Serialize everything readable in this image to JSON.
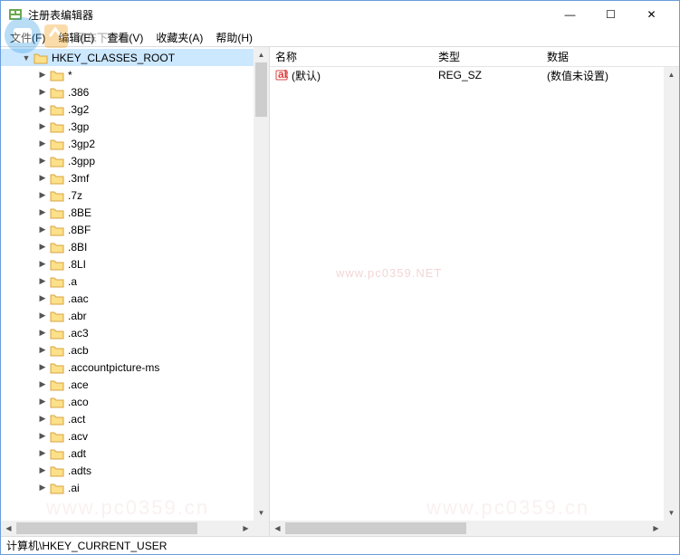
{
  "window": {
    "title": "注册表编辑器"
  },
  "menu": {
    "file": "文件(F)",
    "edit": "编辑(E)",
    "view": "查看(V)",
    "favorites": "收藏夹(A)",
    "help": "帮助(H)"
  },
  "tree": {
    "root": "HKEY_CLASSES_ROOT",
    "items": [
      "*",
      ".386",
      ".3g2",
      ".3gp",
      ".3gp2",
      ".3gpp",
      ".3mf",
      ".7z",
      ".8BE",
      ".8BF",
      ".8BI",
      ".8LI",
      ".a",
      ".aac",
      ".abr",
      ".ac3",
      ".acb",
      ".accountpicture-ms",
      ".ace",
      ".aco",
      ".act",
      ".acv",
      ".adt",
      ".adts",
      ".ai"
    ]
  },
  "list": {
    "columns": {
      "name": "名称",
      "type": "类型",
      "data": "数据"
    },
    "rows": [
      {
        "name": "(默认)",
        "type": "REG_SZ",
        "data": "(数值未设置)"
      }
    ]
  },
  "statusbar": {
    "path": "计算机\\HKEY_CURRENT_USER"
  },
  "watermarks": {
    "site_cn": "河东下载站",
    "url1": "www.pc0359.NET",
    "url2": "www.pc0359.cn"
  },
  "icons": {
    "expand_closed": "▶",
    "expand_open": "▼",
    "up": "▲",
    "down": "▼",
    "left": "◀",
    "right": "▶",
    "minimize": "—",
    "maximize": "☐",
    "close": "✕"
  }
}
